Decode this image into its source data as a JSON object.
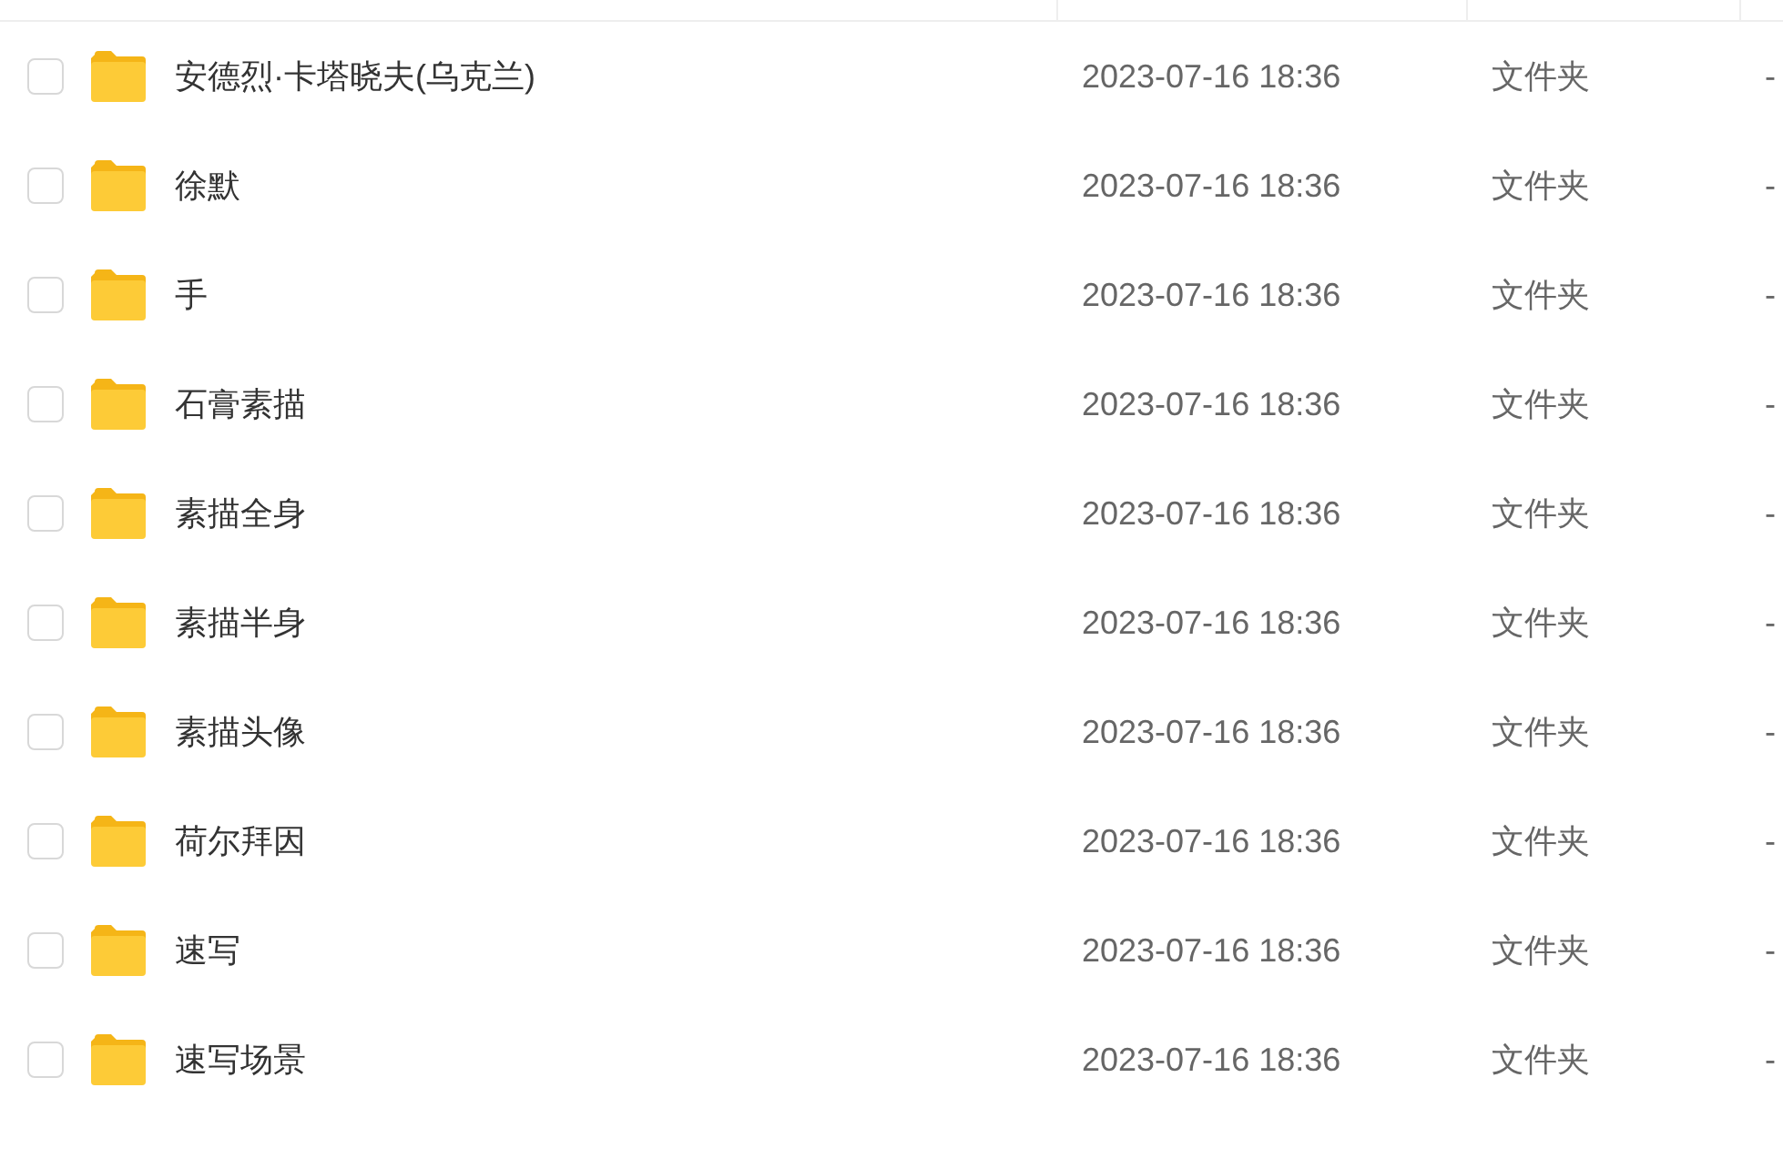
{
  "rows": [
    {
      "name": "安德烈·卡塔晓夫(乌克兰)",
      "modified": "2023-07-16 18:36",
      "type": "文件夹",
      "size": "-",
      "checked": false
    },
    {
      "name": "徐默",
      "modified": "2023-07-16 18:36",
      "type": "文件夹",
      "size": "-",
      "checked": false
    },
    {
      "name": "手",
      "modified": "2023-07-16 18:36",
      "type": "文件夹",
      "size": "-",
      "checked": false
    },
    {
      "name": "石膏素描",
      "modified": "2023-07-16 18:36",
      "type": "文件夹",
      "size": "-",
      "checked": false
    },
    {
      "name": "素描全身",
      "modified": "2023-07-16 18:36",
      "type": "文件夹",
      "size": "-",
      "checked": false
    },
    {
      "name": "素描半身",
      "modified": "2023-07-16 18:36",
      "type": "文件夹",
      "size": "-",
      "checked": false
    },
    {
      "name": "素描头像",
      "modified": "2023-07-16 18:36",
      "type": "文件夹",
      "size": "-",
      "checked": false
    },
    {
      "name": "荷尔拜因",
      "modified": "2023-07-16 18:36",
      "type": "文件夹",
      "size": "-",
      "checked": false
    },
    {
      "name": "速写",
      "modified": "2023-07-16 18:36",
      "type": "文件夹",
      "size": "-",
      "checked": false
    },
    {
      "name": "速写场景",
      "modified": "2023-07-16 18:36",
      "type": "文件夹",
      "size": "-",
      "checked": false
    }
  ]
}
